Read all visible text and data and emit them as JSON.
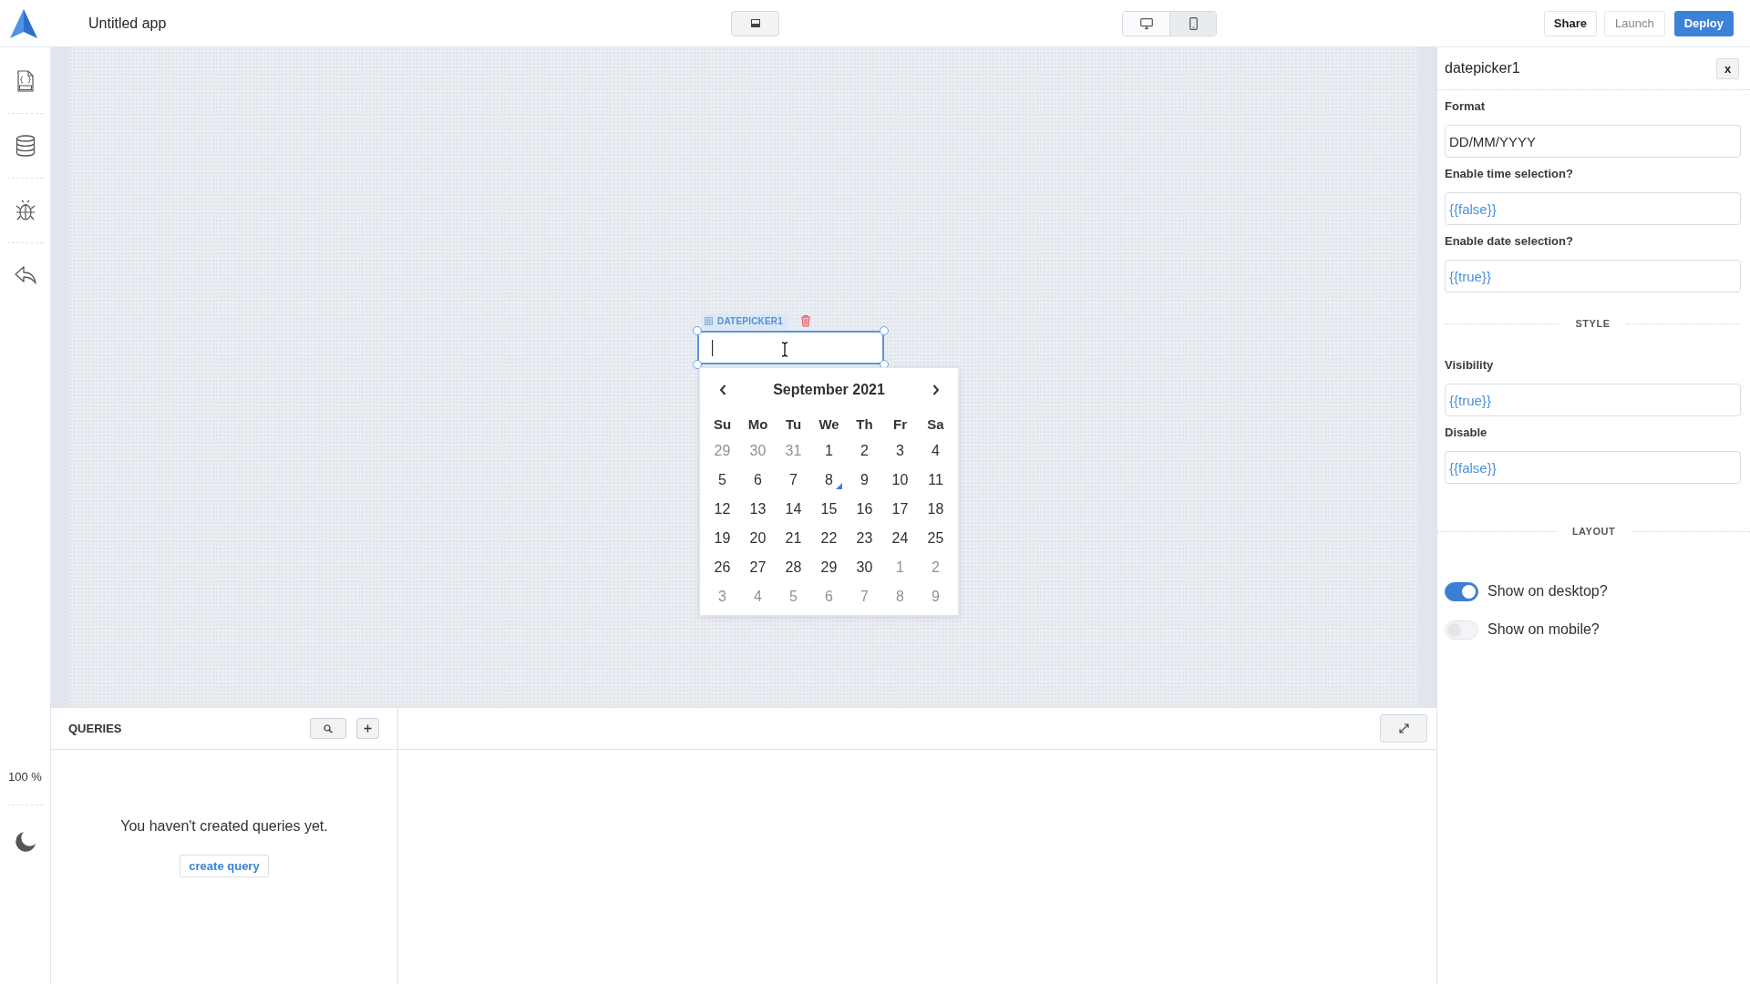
{
  "header": {
    "title": "Untitled app",
    "device_modes": [
      {
        "kind": "desktop",
        "selected": true
      },
      {
        "kind": "mobile",
        "selected": false
      }
    ],
    "actions": [
      {
        "label": "Share",
        "kind": "outline"
      },
      {
        "label": "Launch",
        "kind": "muted"
      },
      {
        "label": "Deploy",
        "kind": "primary"
      }
    ]
  },
  "sidebar": {
    "zoom": "100 %"
  },
  "canvas": {
    "widget": {
      "label": "DATEPICKER1",
      "calendar": {
        "month": "September 2021",
        "weekdays": [
          "Su",
          "Mo",
          "Tu",
          "We",
          "Th",
          "Fr",
          "Sa"
        ],
        "weeks": [
          [
            {
              "day": "29",
              "outside": true,
              "today": false
            },
            {
              "day": "30",
              "outside": true,
              "today": false
            },
            {
              "day": "31",
              "outside": true,
              "today": false
            },
            {
              "day": "1",
              "outside": false,
              "today": false
            },
            {
              "day": "2",
              "outside": false,
              "today": false
            },
            {
              "day": "3",
              "outside": false,
              "today": false
            },
            {
              "day": "4",
              "outside": false,
              "today": false
            }
          ],
          [
            {
              "day": "5",
              "outside": false,
              "today": false
            },
            {
              "day": "6",
              "outside": false,
              "today": false
            },
            {
              "day": "7",
              "outside": false,
              "today": false
            },
            {
              "day": "8",
              "outside": false,
              "today": true
            },
            {
              "day": "9",
              "outside": false,
              "today": false
            },
            {
              "day": "10",
              "outside": false,
              "today": false
            },
            {
              "day": "11",
              "outside": false,
              "today": false
            }
          ],
          [
            {
              "day": "12",
              "outside": false,
              "today": false
            },
            {
              "day": "13",
              "outside": false,
              "today": false
            },
            {
              "day": "14",
              "outside": false,
              "today": false
            },
            {
              "day": "15",
              "outside": false,
              "today": false
            },
            {
              "day": "16",
              "outside": false,
              "today": false
            },
            {
              "day": "17",
              "outside": false,
              "today": false
            },
            {
              "day": "18",
              "outside": false,
              "today": false
            }
          ],
          [
            {
              "day": "19",
              "outside": false,
              "today": false
            },
            {
              "day": "20",
              "outside": false,
              "today": false
            },
            {
              "day": "21",
              "outside": false,
              "today": false
            },
            {
              "day": "22",
              "outside": false,
              "today": false
            },
            {
              "day": "23",
              "outside": false,
              "today": false
            },
            {
              "day": "24",
              "outside": false,
              "today": false
            },
            {
              "day": "25",
              "outside": false,
              "today": false
            }
          ],
          [
            {
              "day": "26",
              "outside": false,
              "today": false
            },
            {
              "day": "27",
              "outside": false,
              "today": false
            },
            {
              "day": "28",
              "outside": false,
              "today": false
            },
            {
              "day": "29",
              "outside": false,
              "today": false
            },
            {
              "day": "30",
              "outside": false,
              "today": false
            },
            {
              "day": "1",
              "outside": true,
              "today": false
            },
            {
              "day": "2",
              "outside": true,
              "today": false
            }
          ],
          [
            {
              "day": "3",
              "outside": true,
              "today": false
            },
            {
              "day": "4",
              "outside": true,
              "today": false
            },
            {
              "day": "5",
              "outside": true,
              "today": false
            },
            {
              "day": "6",
              "outside": true,
              "today": false
            },
            {
              "day": "7",
              "outside": true,
              "today": false
            },
            {
              "day": "8",
              "outside": true,
              "today": false
            },
            {
              "day": "9",
              "outside": true,
              "today": false
            }
          ]
        ]
      }
    }
  },
  "inspector": {
    "title": "datepicker1",
    "close_label": "x",
    "properties": [
      {
        "label": "Format",
        "value": "DD/MM/YYYY",
        "kind": "text"
      },
      {
        "label": "Enable time selection?",
        "value": "{{false}}",
        "kind": "code"
      },
      {
        "label": "Enable date selection?",
        "value": "{{true}}",
        "kind": "code"
      }
    ],
    "style": {
      "heading": "STYLE",
      "properties": [
        {
          "label": "Visibility",
          "value": "{{true}}",
          "kind": "code"
        },
        {
          "label": "Disable",
          "value": "{{false}}",
          "kind": "code"
        }
      ]
    },
    "layout": {
      "heading": "LAYOUT",
      "toggles": [
        {
          "label": "Show on desktop?",
          "on": true
        },
        {
          "label": "Show on mobile?",
          "on": false
        }
      ]
    }
  },
  "queries": {
    "title": "QUERIES",
    "empty_message": "You haven't created queries yet.",
    "create_label": "create query"
  }
}
